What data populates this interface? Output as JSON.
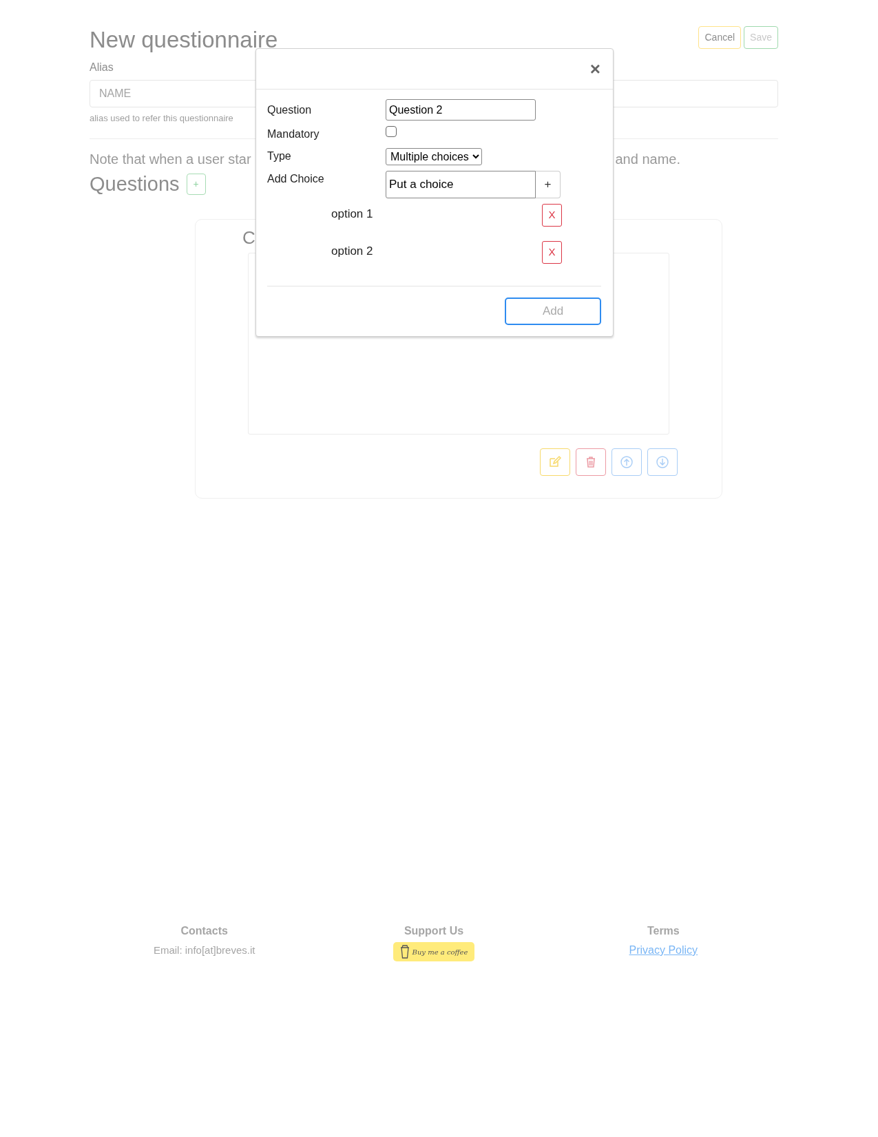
{
  "page": {
    "title": "New questionnaire",
    "buttons": [
      {
        "label": "Cancel",
        "kind": "cancel"
      },
      {
        "label": "Save",
        "kind": "save"
      }
    ]
  },
  "alias": {
    "label": "Alias",
    "placeholder": "NAME",
    "help": "alias used to refer this questionnaire"
  },
  "note": {
    "left": "Note that when a user star",
    "right": "and name."
  },
  "questions": {
    "heading": "Questions",
    "add_button": "+",
    "card": {
      "title": "C",
      "actions": [
        {
          "kind": "edit"
        },
        {
          "kind": "delete"
        },
        {
          "kind": "up"
        },
        {
          "kind": "down"
        }
      ]
    }
  },
  "modal": {
    "close": "×",
    "fields": [
      {
        "kind": "text",
        "label": "Question",
        "value": "Question 2"
      },
      {
        "kind": "checkbox",
        "label": "Mandatory",
        "checked": false
      },
      {
        "kind": "select",
        "label": "Type",
        "value": "Multiple choices"
      },
      {
        "kind": "addchoice",
        "label": "Add Choice",
        "value": "Put a choice",
        "button": "+"
      }
    ],
    "choices": [
      {
        "text": "option 1",
        "remove": "X"
      },
      {
        "text": "option 2",
        "remove": "X"
      }
    ],
    "submit": "Add"
  },
  "footer": {
    "columns": [
      {
        "heading": "Contacts",
        "kind": "text",
        "text": "Email: info[at]breves.it"
      },
      {
        "heading": "Support Us",
        "kind": "coffee",
        "text": "Buy me a coffee"
      },
      {
        "heading": "Terms",
        "kind": "link",
        "text": "Privacy Policy"
      }
    ]
  }
}
